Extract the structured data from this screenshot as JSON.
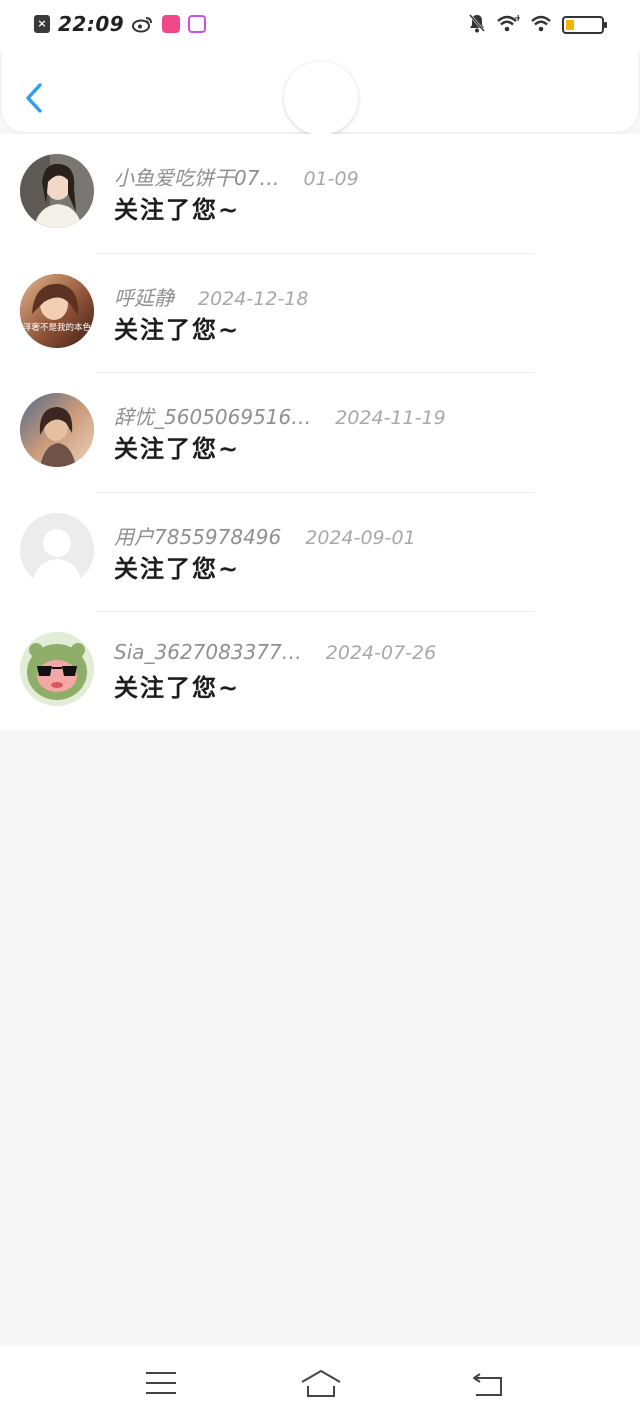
{
  "status_bar": {
    "time": "22:09",
    "close_glyph": "×",
    "icons": [
      "close-notification-icon",
      "weibo-icon",
      "app-pink-icon",
      "app-100-icon",
      "bell-muted-icon",
      "wifi-plus-icon",
      "wifi-icon",
      "battery-icon"
    ],
    "battery_level": 0.2,
    "battery_color": "#f5b400"
  },
  "header": {
    "back_icon": "chevron-left-icon",
    "accent": "#2a9df4"
  },
  "notifications": [
    {
      "name": "小鱼爱吃饼干07…",
      "date": "01-09",
      "message": "关注了您~"
    },
    {
      "name": "呼延静",
      "date": "2024-12-18",
      "message": "关注了您~"
    },
    {
      "name": "辞忧_5605069516…",
      "date": "2024-11-19",
      "message": "关注了您~"
    },
    {
      "name": "用户7855978496",
      "date": "2024-09-01",
      "message": "关注了您~"
    },
    {
      "name": "Sia_3627083377…",
      "date": "2024-07-26",
      "message": "关注了您~"
    }
  ],
  "avatar_caption": "浮奢不是我的本色",
  "nav_bar": {
    "icons": [
      "menu-icon",
      "home-icon",
      "back-icon"
    ]
  }
}
